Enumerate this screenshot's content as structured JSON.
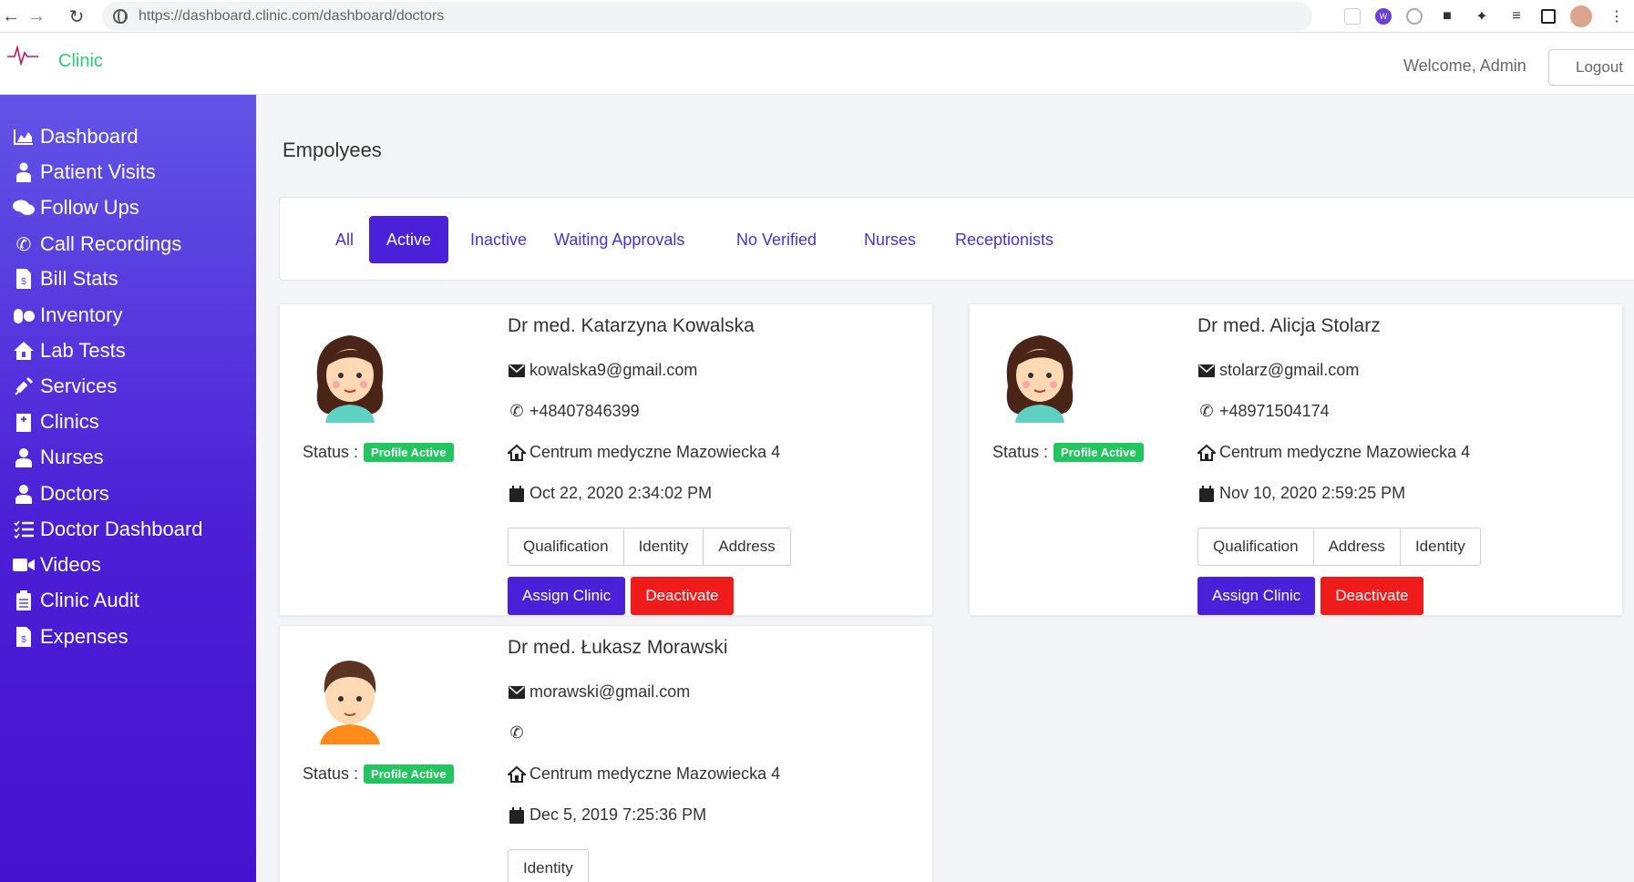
{
  "browser": {
    "url_host": "https://dashboard.clinic.com",
    "url_path": "/dashboard/doctors"
  },
  "header": {
    "brand": "Clinic",
    "welcome": "Welcome, Admin",
    "logout_label": "Logout"
  },
  "sidebar": {
    "items": [
      {
        "label": "Dashboard",
        "icon": "chart-area-icon"
      },
      {
        "label": "Patient Visits",
        "icon": "user-injured-icon"
      },
      {
        "label": "Follow Ups",
        "icon": "comments-icon"
      },
      {
        "label": "Call Recordings",
        "icon": "phone-icon"
      },
      {
        "label": "Bill Stats",
        "icon": "file-invoice-dollar-icon"
      },
      {
        "label": "Inventory",
        "icon": "pills-icon"
      },
      {
        "label": "Lab Tests",
        "icon": "clinic-house-icon"
      },
      {
        "label": "Services",
        "icon": "syringe-icon"
      },
      {
        "label": "Clinics",
        "icon": "hospital-icon"
      },
      {
        "label": "Nurses",
        "icon": "user-nurse-icon"
      },
      {
        "label": "Doctors",
        "icon": "user-md-icon"
      },
      {
        "label": "Doctor Dashboard",
        "icon": "list-check-icon"
      },
      {
        "label": "Videos",
        "icon": "video-icon"
      },
      {
        "label": "Clinic Audit",
        "icon": "clipboard-list-icon"
      },
      {
        "label": "Expenses",
        "icon": "file-invoice-dollar-icon"
      }
    ]
  },
  "main": {
    "title": "Empolyees",
    "tabs": [
      {
        "label": "All",
        "active": false
      },
      {
        "label": "Active",
        "active": true
      },
      {
        "label": "Inactive",
        "active": false
      },
      {
        "label": "Waiting Approvals",
        "active": false
      },
      {
        "label": "No Verified",
        "active": false
      },
      {
        "label": "Nurses",
        "active": false
      },
      {
        "label": "Receptionists",
        "active": false
      }
    ],
    "doctors": [
      {
        "name": "Dr med. Katarzyna Kowalska",
        "email": "kowalska9@gmail.com",
        "phone": "+48407846399",
        "clinic": "Centrum medyczne Mazowiecka 4",
        "date": "Oct 22, 2020 2:34:02 PM",
        "status_label": "Status :",
        "status_badge": "Profile Active",
        "avatar": "female-doctor-avatar-icon",
        "doc_buttons": [
          "Qualification",
          "Identity",
          "Address"
        ],
        "assign_label": "Assign Clinic",
        "deactivate_label": "Deactivate"
      },
      {
        "name": "Dr med. Alicja Stolarz",
        "email": "stolarz@gmail.com",
        "phone": "+48971504174",
        "clinic": "Centrum medyczne Mazowiecka 4",
        "date": "Nov 10, 2020 2:59:25 PM",
        "status_label": "Status :",
        "status_badge": "Profile Active",
        "avatar": "female-doctor-avatar-icon",
        "doc_buttons": [
          "Qualification",
          "Address",
          "Identity"
        ],
        "assign_label": "Assign Clinic",
        "deactivate_label": "Deactivate"
      },
      {
        "name": "Dr med. Łukasz Morawski",
        "email": "morawski@gmail.com",
        "phone": "",
        "clinic": "Centrum medyczne Mazowiecka 4",
        "date": "Dec 5, 2019 7:25:36 PM",
        "status_label": "Status :",
        "status_badge": "Profile Active",
        "avatar": "male-doctor-avatar-icon",
        "doc_buttons": [
          "Identity"
        ]
      }
    ]
  },
  "colors": {
    "accent": "#4a20d8",
    "danger": "#f01c1c",
    "success": "#22c55e",
    "brand": "#2ecc71"
  }
}
